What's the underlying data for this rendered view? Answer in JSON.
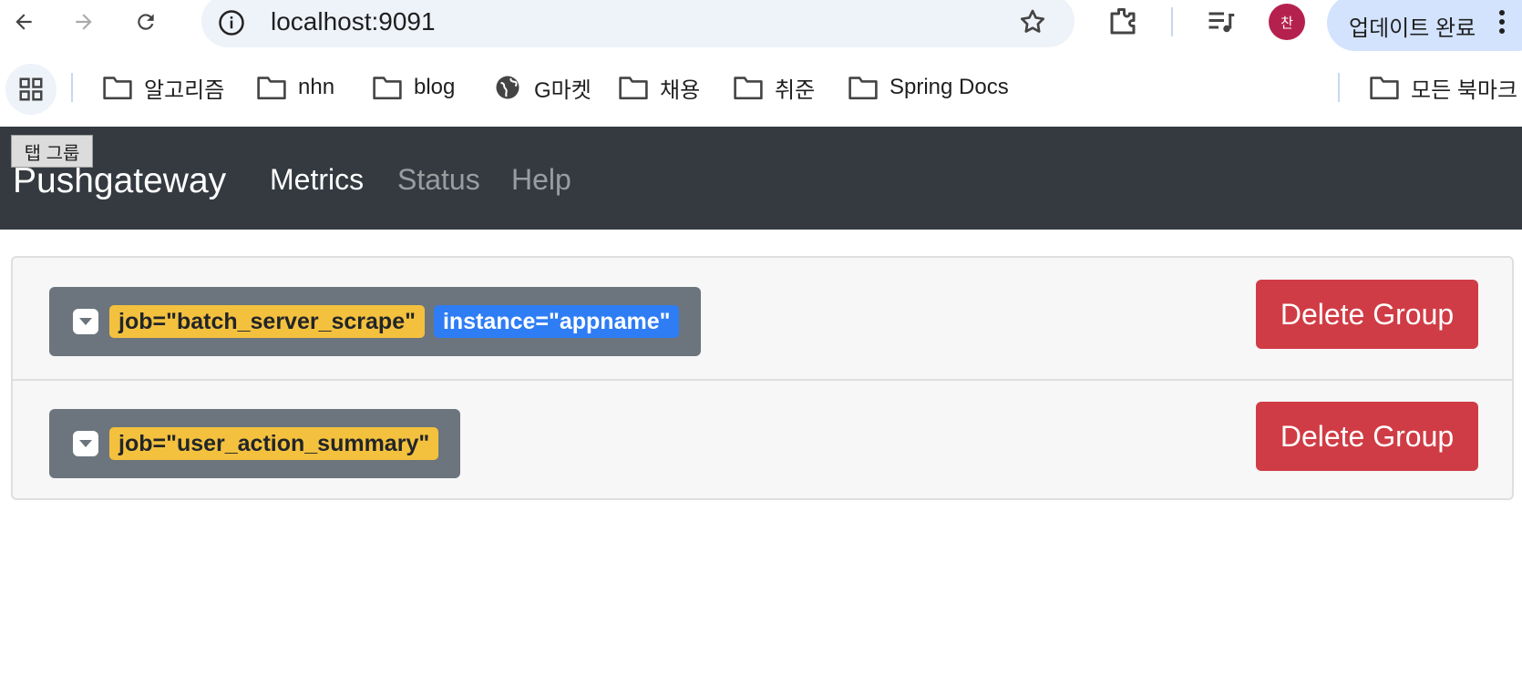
{
  "browser": {
    "url": "localhost:9091",
    "profile_initial": "찬",
    "update_label": "업데이트 완료",
    "bookmarks": [
      {
        "label": "알고리즘",
        "icon": "folder-icon"
      },
      {
        "label": "nhn",
        "icon": "folder-icon"
      },
      {
        "label": "blog",
        "icon": "folder-icon"
      },
      {
        "label": "G마켓",
        "icon": "globe-icon"
      },
      {
        "label": "채용",
        "icon": "folder-icon"
      },
      {
        "label": "취준",
        "icon": "folder-icon"
      },
      {
        "label": "Spring Docs",
        "icon": "folder-icon"
      }
    ],
    "all_bookmarks_label": "모든 북마크",
    "tab_group_tooltip": "탭 그룹"
  },
  "navbar": {
    "brand": "Pushgateway",
    "links": [
      "Metrics",
      "Status",
      "Help"
    ],
    "active_link": "Metrics"
  },
  "groups": [
    {
      "labels": [
        {
          "type": "job",
          "text": "job=\"batch_server_scrape\""
        },
        {
          "type": "instance",
          "text": "instance=\"appname\""
        }
      ],
      "delete_label": "Delete Group"
    },
    {
      "labels": [
        {
          "type": "job",
          "text": "job=\"user_action_summary\""
        }
      ],
      "delete_label": "Delete Group"
    }
  ],
  "colors": {
    "navbar_bg": "#343a40",
    "job_badge": "#f4c13e",
    "instance_badge": "#2f7df4",
    "delete_button": "#d03c45",
    "group_head": "#6c757d"
  }
}
